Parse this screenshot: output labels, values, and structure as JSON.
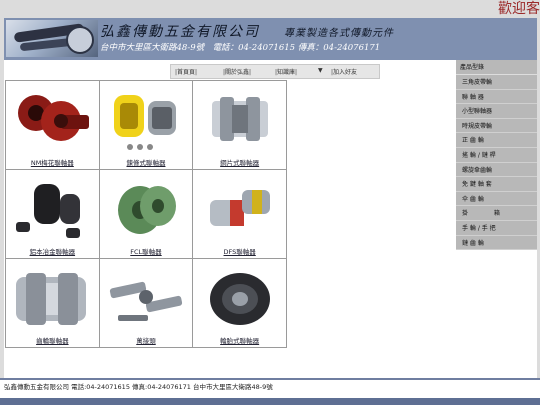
{
  "marquee": {
    "text": "歡迎客"
  },
  "banner": {
    "company_name": "弘鑫傳動五金有限公司",
    "tagline": "專業製造各式傳動元件",
    "contact": "台中市大里區大衛路48-9號　電話：04-24071615  傳真：04-24076171"
  },
  "topnav": {
    "items": [
      "首頁頁",
      "關於弘鑫",
      "知識庫",
      "加入好友"
    ],
    "dropdown_arrow": "▼"
  },
  "products": [
    {
      "name": "NM梅花聯軸器",
      "icon": "jaw-coupling-red"
    },
    {
      "name": "鍊條式聯軸器",
      "icon": "chain-coupling-yellow"
    },
    {
      "name": "鋼片式聯軸器",
      "icon": "disc-coupling-steel"
    },
    {
      "name": "鋁本冶金聯軸器",
      "icon": "jaw-coupling-black"
    },
    {
      "name": "FCL聯軸器",
      "icon": "fcl-coupling-green"
    },
    {
      "name": "DFS聯軸器",
      "icon": "dfs-coupling-red-grey"
    },
    {
      "name": "齒輪聯軸器",
      "icon": "gear-coupling-steel"
    },
    {
      "name": "萬接頭",
      "icon": "universal-joint"
    },
    {
      "name": "輪胎式聯軸器",
      "icon": "tire-coupling-black"
    }
  ],
  "sidebar": {
    "heading": "產品型錄",
    "items": [
      "三角皮帶輪",
      "聯 軸 器",
      "小型聯軸器",
      "時規皮帶輪",
      "正 齒 輪",
      "搖 輪 / 鏈 桿",
      "螺旋傘齒輪",
      "免 鍵 軸 套",
      "伞 齒 輪",
      "掛　　　　 箱",
      "手 輪 / 手 把",
      "鏈 齒 輪"
    ]
  },
  "footer": {
    "text": "弘鑫傳動五金有限公司 電話:04-24071615 傳真:04-24076171 台中市大里區大衛路48-9號"
  },
  "colors": {
    "banner": "#7f90b0",
    "sidebar": "#b8b8b8",
    "marquee": "#9b2a2a",
    "footer_strip": "#5e6f93"
  }
}
